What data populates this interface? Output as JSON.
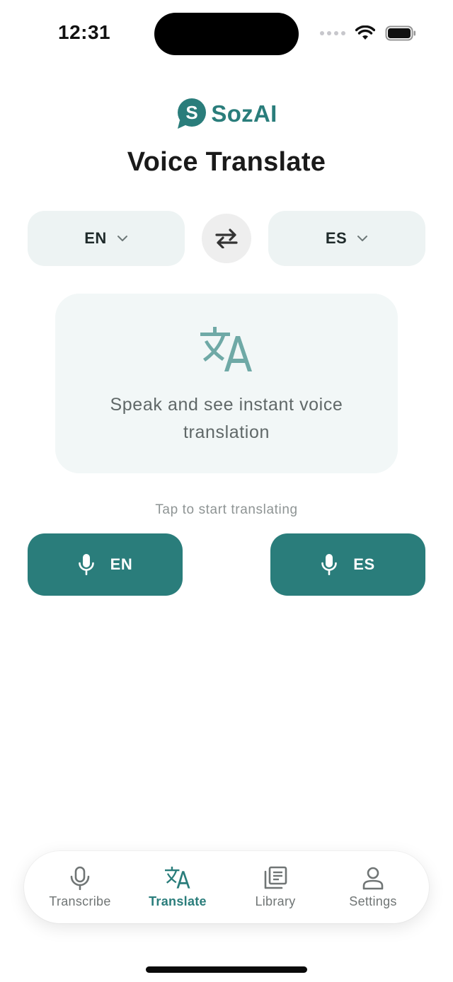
{
  "status_bar": {
    "time": "12:31",
    "icons": [
      "signal-dots-icon",
      "wifi-icon",
      "battery-icon"
    ]
  },
  "brand": {
    "logo_letter": "S",
    "name": "SozAI"
  },
  "page": {
    "title": "Voice Translate"
  },
  "languages": {
    "source": "EN",
    "target": "ES",
    "swap_icon": "swap-arrows-icon",
    "chevron_icon": "chevron-down-icon"
  },
  "card": {
    "icon": "translate-icon",
    "text": "Speak and see instant voice translation"
  },
  "hint": "Tap to start translating",
  "mic_buttons": [
    {
      "icon": "microphone-icon",
      "label": "EN"
    },
    {
      "icon": "microphone-icon",
      "label": "ES"
    }
  ],
  "tabs": [
    {
      "icon": "microphone-icon",
      "label": "Transcribe",
      "active": false
    },
    {
      "icon": "translate-icon",
      "label": "Translate",
      "active": true
    },
    {
      "icon": "library-icon",
      "label": "Library",
      "active": false
    },
    {
      "icon": "person-icon",
      "label": "Settings",
      "active": false
    }
  ],
  "colors": {
    "accent": "#2a7d7b",
    "select_bg": "#edf3f3",
    "card_bg": "#f2f7f7",
    "inactive_tab": "#707575"
  }
}
